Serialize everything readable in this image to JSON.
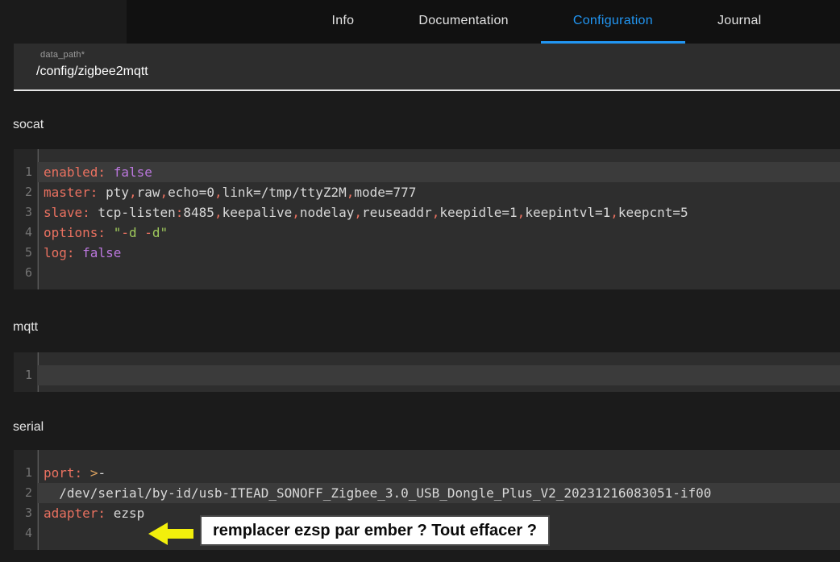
{
  "colors": {
    "accent": "#2196f3",
    "page_bg": "#1b1b1b",
    "tabbar_bg": "#111111",
    "editor_bg": "#2e2e2e",
    "gutter_bg": "#262626",
    "active_line_bg": "#3b3b3b",
    "token_key": "#ea7160",
    "token_atom": "#bb77dd",
    "token_string": "#9fc95c",
    "token_op": "#dba15f",
    "token_plain": "#d8d8d8",
    "annotation_arrow": "#f2ef0c"
  },
  "tabs": [
    {
      "label": "Info",
      "active": false
    },
    {
      "label": "Documentation",
      "active": false
    },
    {
      "label": "Configuration",
      "active": true
    },
    {
      "label": "Journal",
      "active": false
    }
  ],
  "form": {
    "data_path": {
      "label": "data_path*",
      "value": "/config/zigbee2mqtt"
    }
  },
  "sections": [
    {
      "title": "socat",
      "active_line": 1,
      "lines": [
        [
          {
            "c": "key",
            "t": "enabled:"
          },
          {
            "c": "plain",
            "t": " "
          },
          {
            "c": "atom",
            "t": "false"
          }
        ],
        [
          {
            "c": "key",
            "t": "master:"
          },
          {
            "c": "plain",
            "t": " pty"
          },
          {
            "c": "punct",
            "t": ","
          },
          {
            "c": "plain",
            "t": "raw"
          },
          {
            "c": "punct",
            "t": ","
          },
          {
            "c": "plain",
            "t": "echo=0"
          },
          {
            "c": "punct",
            "t": ","
          },
          {
            "c": "plain",
            "t": "link=/tmp/ttyZ2M"
          },
          {
            "c": "punct",
            "t": ","
          },
          {
            "c": "plain",
            "t": "mode=777"
          }
        ],
        [
          {
            "c": "key",
            "t": "slave:"
          },
          {
            "c": "plain",
            "t": " tcp-listen"
          },
          {
            "c": "punct",
            "t": ":"
          },
          {
            "c": "plain",
            "t": "8485"
          },
          {
            "c": "punct",
            "t": ","
          },
          {
            "c": "plain",
            "t": "keepalive"
          },
          {
            "c": "punct",
            "t": ","
          },
          {
            "c": "plain",
            "t": "nodelay"
          },
          {
            "c": "punct",
            "t": ","
          },
          {
            "c": "plain",
            "t": "reuseaddr"
          },
          {
            "c": "punct",
            "t": ","
          },
          {
            "c": "plain",
            "t": "keepidle=1"
          },
          {
            "c": "punct",
            "t": ","
          },
          {
            "c": "plain",
            "t": "keepintvl=1"
          },
          {
            "c": "punct",
            "t": ","
          },
          {
            "c": "plain",
            "t": "keepcnt=5"
          }
        ],
        [
          {
            "c": "key",
            "t": "options:"
          },
          {
            "c": "plain",
            "t": " "
          },
          {
            "c": "string",
            "t": "\""
          },
          {
            "c": "punct",
            "t": "-"
          },
          {
            "c": "string",
            "t": "d "
          },
          {
            "c": "punct",
            "t": "-"
          },
          {
            "c": "string",
            "t": "d\""
          }
        ],
        [
          {
            "c": "key",
            "t": "log:"
          },
          {
            "c": "plain",
            "t": " "
          },
          {
            "c": "atom",
            "t": "false"
          }
        ],
        []
      ]
    },
    {
      "title": "mqtt",
      "active_line": 1,
      "lines": [
        []
      ]
    },
    {
      "title": "serial",
      "active_line": 2,
      "lines": [
        [
          {
            "c": "key",
            "t": "port:"
          },
          {
            "c": "plain",
            "t": " "
          },
          {
            "c": "op",
            "t": ">"
          },
          {
            "c": "plain",
            "t": "-"
          }
        ],
        [
          {
            "c": "plain",
            "t": "  /dev/serial/by-id/usb-ITEAD_SONOFF_Zigbee_3.0_USB_Dongle_Plus_V2_20231216083051-if00"
          }
        ],
        [
          {
            "c": "key",
            "t": "adapter:"
          },
          {
            "c": "plain",
            "t": " ezsp"
          }
        ],
        []
      ]
    }
  ],
  "annotation": {
    "text": "remplacer ezsp par ember ? Tout effacer ?"
  }
}
